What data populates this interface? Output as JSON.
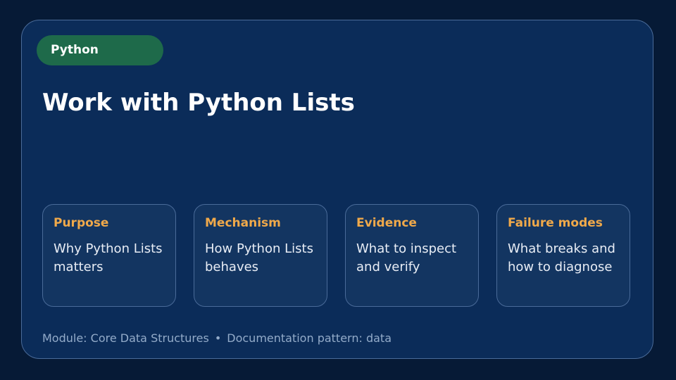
{
  "slide": {
    "tag": "Python",
    "title": "Work with Python Lists",
    "panels": [
      {
        "heading": "Purpose",
        "body": "Why Python Lists matters"
      },
      {
        "heading": "Mechanism",
        "body": "How Python Lists behaves"
      },
      {
        "heading": "Evidence",
        "body": "What to inspect and verify"
      },
      {
        "heading": "Failure modes",
        "body": "What breaks and how to diagnose"
      }
    ],
    "footer": {
      "module": "Module: Core Data Structures",
      "separator": "•",
      "pattern": "Documentation pattern: data"
    }
  },
  "colors": {
    "background": "#061a36",
    "card": "#0b2c59",
    "panel": "#133561",
    "tag": "#1e6a4a",
    "accent": "#f0a94a"
  }
}
